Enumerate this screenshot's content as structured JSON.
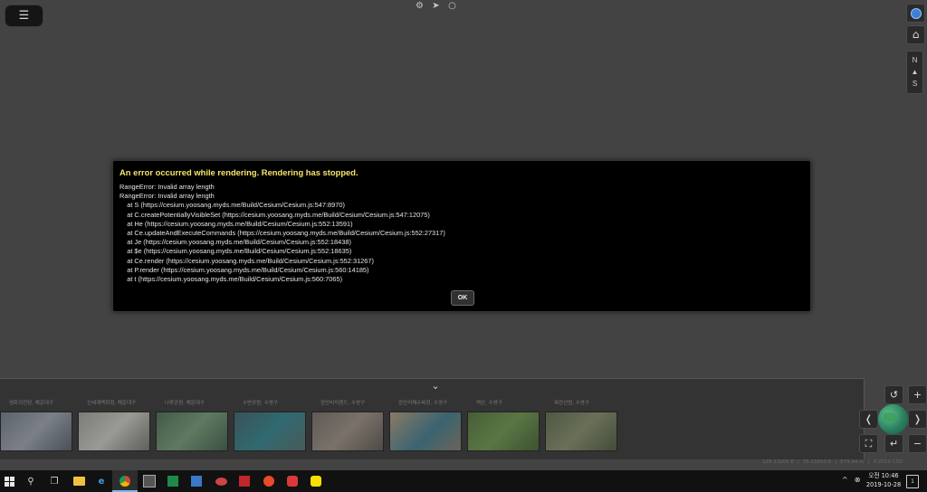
{
  "toolbar": {
    "menu_icon": "hamburger-icon",
    "top_icons": [
      "gear-icon",
      "send-icon",
      "circle-icon"
    ],
    "right_icons": [
      "imagery-layer-icon",
      "home-icon"
    ],
    "compass_letters": [
      "N",
      "S"
    ]
  },
  "dialog": {
    "title": "An error occurred while rendering. Rendering has stopped.",
    "message": "RangeError: Invalid array length\nRangeError: Invalid array length\n    at S (https://cesium.yoosang.myds.me/Build/Cesium/Cesium.js:547:8970)\n    at C.createPotentiallyVisibleSet (https://cesium.yoosang.myds.me/Build/Cesium/Cesium.js:547:12075)\n    at He (https://cesium.yoosang.myds.me/Build/Cesium/Cesium.js:552:13591)\n    at Ce.updateAndExecuteCommands (https://cesium.yoosang.myds.me/Build/Cesium/Cesium.js:552:27317)\n    at Je (https://cesium.yoosang.myds.me/Build/Cesium/Cesium.js:552:18438)\n    at $e (https://cesium.yoosang.myds.me/Build/Cesium/Cesium.js:552:18635)\n    at Ce.render (https://cesium.yoosang.myds.me/Build/Cesium/Cesium.js:552:31267)\n    at P.render (https://cesium.yoosang.myds.me/Build/Cesium/Cesium.js:560:14185)\n    at t (https://cesium.yoosang.myds.me/Build/Cesium/Cesium.js:560:7065)",
    "ok_label": "OK"
  },
  "places": [
    {
      "label": "영화의전당, 해운대구",
      "color": "#6b7078"
    },
    {
      "label": "신세계백화점, 해운대구",
      "color": "#8a8a86"
    },
    {
      "label": "나루공원, 해운대구",
      "color": "#4e6352"
    },
    {
      "label": "수변공원, 수영구",
      "color": "#3d5a5c"
    },
    {
      "label": "광안비치랜드, 수영구",
      "color": "#6a6560"
    },
    {
      "label": "광안리해수욕장, 수영구",
      "color": "#7a6e62"
    },
    {
      "label": "백산, 수영구",
      "color": "#4f6a3e"
    },
    {
      "label": "옥련선원, 수영구",
      "color": "#56604a"
    }
  ],
  "status": {
    "longitude": "129.13205 E",
    "latitude": "35.15653 E",
    "altitude": "879.94 m",
    "credit": "©2019 CSD"
  },
  "taskbar": {
    "clock_ampm": "오전 10:46",
    "clock_date": "2019-10-28",
    "tray_expand": "^",
    "notification_count": "1"
  }
}
